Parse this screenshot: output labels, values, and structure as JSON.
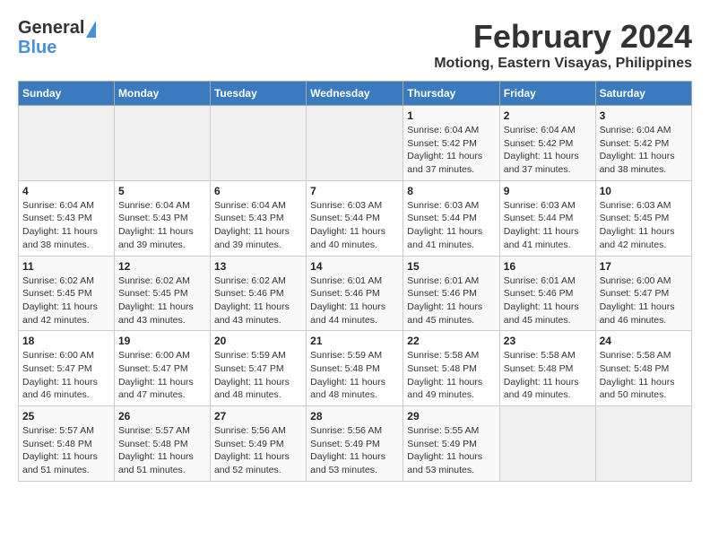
{
  "header": {
    "logo_general": "General",
    "logo_blue": "Blue",
    "title": "February 2024",
    "subtitle": "Motiong, Eastern Visayas, Philippines"
  },
  "days_of_week": [
    "Sunday",
    "Monday",
    "Tuesday",
    "Wednesday",
    "Thursday",
    "Friday",
    "Saturday"
  ],
  "weeks": [
    [
      {
        "day": "",
        "info": "",
        "empty": true
      },
      {
        "day": "",
        "info": "",
        "empty": true
      },
      {
        "day": "",
        "info": "",
        "empty": true
      },
      {
        "day": "",
        "info": "",
        "empty": true
      },
      {
        "day": "1",
        "info": "Sunrise: 6:04 AM\nSunset: 5:42 PM\nDaylight: 11 hours\nand 37 minutes.",
        "empty": false
      },
      {
        "day": "2",
        "info": "Sunrise: 6:04 AM\nSunset: 5:42 PM\nDaylight: 11 hours\nand 37 minutes.",
        "empty": false
      },
      {
        "day": "3",
        "info": "Sunrise: 6:04 AM\nSunset: 5:42 PM\nDaylight: 11 hours\nand 38 minutes.",
        "empty": false
      }
    ],
    [
      {
        "day": "4",
        "info": "Sunrise: 6:04 AM\nSunset: 5:43 PM\nDaylight: 11 hours\nand 38 minutes.",
        "empty": false
      },
      {
        "day": "5",
        "info": "Sunrise: 6:04 AM\nSunset: 5:43 PM\nDaylight: 11 hours\nand 39 minutes.",
        "empty": false
      },
      {
        "day": "6",
        "info": "Sunrise: 6:04 AM\nSunset: 5:43 PM\nDaylight: 11 hours\nand 39 minutes.",
        "empty": false
      },
      {
        "day": "7",
        "info": "Sunrise: 6:03 AM\nSunset: 5:44 PM\nDaylight: 11 hours\nand 40 minutes.",
        "empty": false
      },
      {
        "day": "8",
        "info": "Sunrise: 6:03 AM\nSunset: 5:44 PM\nDaylight: 11 hours\nand 41 minutes.",
        "empty": false
      },
      {
        "day": "9",
        "info": "Sunrise: 6:03 AM\nSunset: 5:44 PM\nDaylight: 11 hours\nand 41 minutes.",
        "empty": false
      },
      {
        "day": "10",
        "info": "Sunrise: 6:03 AM\nSunset: 5:45 PM\nDaylight: 11 hours\nand 42 minutes.",
        "empty": false
      }
    ],
    [
      {
        "day": "11",
        "info": "Sunrise: 6:02 AM\nSunset: 5:45 PM\nDaylight: 11 hours\nand 42 minutes.",
        "empty": false
      },
      {
        "day": "12",
        "info": "Sunrise: 6:02 AM\nSunset: 5:45 PM\nDaylight: 11 hours\nand 43 minutes.",
        "empty": false
      },
      {
        "day": "13",
        "info": "Sunrise: 6:02 AM\nSunset: 5:46 PM\nDaylight: 11 hours\nand 43 minutes.",
        "empty": false
      },
      {
        "day": "14",
        "info": "Sunrise: 6:01 AM\nSunset: 5:46 PM\nDaylight: 11 hours\nand 44 minutes.",
        "empty": false
      },
      {
        "day": "15",
        "info": "Sunrise: 6:01 AM\nSunset: 5:46 PM\nDaylight: 11 hours\nand 45 minutes.",
        "empty": false
      },
      {
        "day": "16",
        "info": "Sunrise: 6:01 AM\nSunset: 5:46 PM\nDaylight: 11 hours\nand 45 minutes.",
        "empty": false
      },
      {
        "day": "17",
        "info": "Sunrise: 6:00 AM\nSunset: 5:47 PM\nDaylight: 11 hours\nand 46 minutes.",
        "empty": false
      }
    ],
    [
      {
        "day": "18",
        "info": "Sunrise: 6:00 AM\nSunset: 5:47 PM\nDaylight: 11 hours\nand 46 minutes.",
        "empty": false
      },
      {
        "day": "19",
        "info": "Sunrise: 6:00 AM\nSunset: 5:47 PM\nDaylight: 11 hours\nand 47 minutes.",
        "empty": false
      },
      {
        "day": "20",
        "info": "Sunrise: 5:59 AM\nSunset: 5:47 PM\nDaylight: 11 hours\nand 48 minutes.",
        "empty": false
      },
      {
        "day": "21",
        "info": "Sunrise: 5:59 AM\nSunset: 5:48 PM\nDaylight: 11 hours\nand 48 minutes.",
        "empty": false
      },
      {
        "day": "22",
        "info": "Sunrise: 5:58 AM\nSunset: 5:48 PM\nDaylight: 11 hours\nand 49 minutes.",
        "empty": false
      },
      {
        "day": "23",
        "info": "Sunrise: 5:58 AM\nSunset: 5:48 PM\nDaylight: 11 hours\nand 49 minutes.",
        "empty": false
      },
      {
        "day": "24",
        "info": "Sunrise: 5:58 AM\nSunset: 5:48 PM\nDaylight: 11 hours\nand 50 minutes.",
        "empty": false
      }
    ],
    [
      {
        "day": "25",
        "info": "Sunrise: 5:57 AM\nSunset: 5:48 PM\nDaylight: 11 hours\nand 51 minutes.",
        "empty": false
      },
      {
        "day": "26",
        "info": "Sunrise: 5:57 AM\nSunset: 5:48 PM\nDaylight: 11 hours\nand 51 minutes.",
        "empty": false
      },
      {
        "day": "27",
        "info": "Sunrise: 5:56 AM\nSunset: 5:49 PM\nDaylight: 11 hours\nand 52 minutes.",
        "empty": false
      },
      {
        "day": "28",
        "info": "Sunrise: 5:56 AM\nSunset: 5:49 PM\nDaylight: 11 hours\nand 53 minutes.",
        "empty": false
      },
      {
        "day": "29",
        "info": "Sunrise: 5:55 AM\nSunset: 5:49 PM\nDaylight: 11 hours\nand 53 minutes.",
        "empty": false
      },
      {
        "day": "",
        "info": "",
        "empty": true
      },
      {
        "day": "",
        "info": "",
        "empty": true
      }
    ]
  ]
}
